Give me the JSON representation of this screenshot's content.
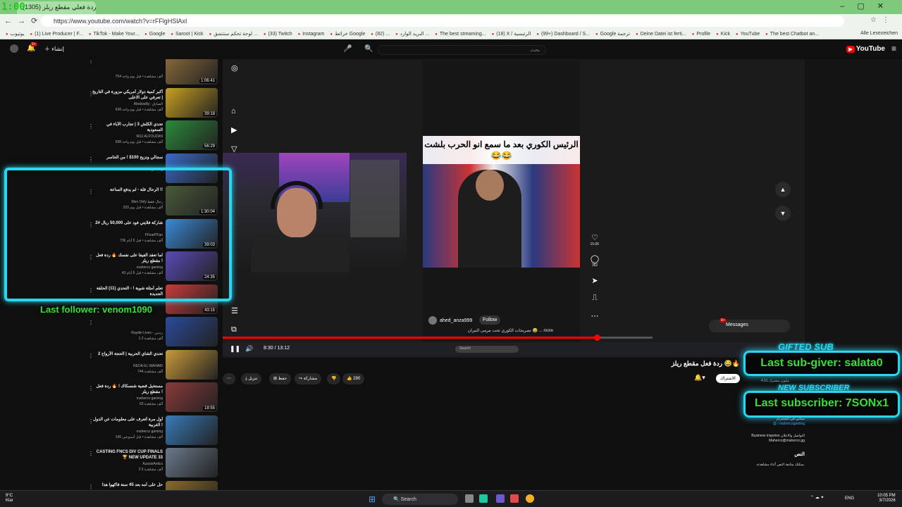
{
  "overlay": {
    "timer": "1:00",
    "last_follower": "Last follower: venom1090",
    "gifted_label": "GIFTED SUB",
    "last_sub_giver": "Last sub-giver: salata0",
    "new_sub_label": "NEW SUBSCRIBER",
    "last_subscriber": "Last subscriber: 7SONx1",
    "box_color": "#2ad6ef",
    "text_color": "#36e036"
  },
  "browser": {
    "tab_title": "(1305) ردة فعلي مقطع ريلز",
    "url": "https://www.youtube.com/watch?v=rFFlgHSlAxI",
    "bookmarks": [
      "يوتيوب",
      "(1) Live Producer | F...",
      "TikTok - Make Your...",
      "Google",
      "Saroot | Kick",
      "لوحة تحكم ستتشق ...",
      "(33) Twitch",
      "Instagram",
      "خرائط Google",
      "(82) ...",
      "البريد الوارد ...",
      "The best streaming...",
      "(18) X / الرئيسية",
      "(99+) Dashboard / S...",
      "Google ترجمة",
      "Deine Datei ist ferti...",
      "Profile",
      "Kick",
      "YouTube",
      "The best Chatbot an..."
    ],
    "all_bookmarks": "Alle Lesezeichen"
  },
  "youtube": {
    "logo": "YouTube",
    "search_placeholder": "بحث",
    "create_label": "إنشاء",
    "notif_count": "9+"
  },
  "sidebar": {
    "items": [
      {
        "title": "",
        "channel": "",
        "meta": "754 ألف مشاهدة • قبل يوم واحد",
        "duration": "1:06:41",
        "color": "#8a6a3a"
      },
      {
        "title": "أكبر كمية دولار أمريكي مزورة في التاريخ | تعرفي على الاعلى",
        "channel": "Abalsadiq - الصادق",
        "meta": "638 ألف مشاهدة • قبل يوم واحد",
        "duration": "39:18",
        "color": "#c8a020"
      },
      {
        "title": "تحدي الكلش 3 | تجارب الأباء في السعودية",
        "channel": "M12 ALFOUZAN",
        "meta": "598 ألف مشاهدة • قبل يوم واحد",
        "duration": "56:29",
        "color": "#2a8a3a"
      },
      {
        "title": "سجالي ونزيح 100$ ! من الخاسر",
        "channel": "maherco gaming",
        "meta": "",
        "duration": "",
        "color": "#3a6ac8"
      },
      {
        "title": "الرحال فلة - لم يدفع الساعة !!",
        "channel": "Men Only رجال فقط",
        "meta": "333 ألف مشاهدة • قبل يوم",
        "duration": "1:30:04",
        "color": "#4a5a3a"
      },
      {
        "title": "شاركة فلايتي فود على 50,000 ريال #2",
        "channel": "FFearPFan",
        "meta": "736 ألف مشاهدة • قبل 6 أيام",
        "duration": "39:03",
        "color": "#3a8ad8"
      },
      {
        "title": "لما تعقد الفيفا على نفسك 🔥 ردة فعل مقطع ريلز !",
        "channel": "maherco gaming",
        "meta": "43 ألف مشاهدة • قبل 6 أيام",
        "duration": "24:35",
        "color": "#5a4ab8"
      },
      {
        "title": "تعلم أمثلة شوية ! - التحدي (11) الحلقة الجديدة",
        "channel": "AZAD",
        "meta": "",
        "duration": "43:15",
        "color": "#c83a3a"
      },
      {
        "title": "",
        "channel": "Raydin Lives - ريدين",
        "meta": "1.2 ألف مشاهدة",
        "duration": "",
        "color": "#2a4a9a"
      },
      {
        "title": "تحدي الشاي الحربية | الحجة الأرواح 2",
        "channel": "REDA EL WAHABI",
        "meta": "744 ألف مشاهدة",
        "duration": "",
        "color": "#c89a3a"
      },
      {
        "title": "مستخيل قضية شنسكاك ! 🔥 ردة فعل مقطع ريلز !",
        "channel": "maherco gaming",
        "meta": "63 ألف مشاهدة",
        "duration": "18:55",
        "color": "#8a3a3a"
      },
      {
        "title": "أول مرة أتعرف على معلومات عن الدول الغربية !",
        "channel": "maherco gaming",
        "meta": "106 ألف مشاهدة • قبل أسبوعين",
        "duration": "",
        "color": "#3a7ab8"
      },
      {
        "title": "CASTING FNCS DIV CUP FINALS 🏆 NEW UPDATE 33",
        "channel": "AussieAntics",
        "meta": "2.5 ألف مشاهدة",
        "duration": "",
        "color": "#6a7a8a"
      },
      {
        "title": "حل على أمه بعد 45 سنة فاكهوا هذا",
        "channel": "maherco gaming",
        "meta": "",
        "duration": "",
        "color": "#8a6a2a"
      }
    ]
  },
  "player": {
    "short_caption": "الرئيس الكوري بعد ما سمع انو الحرب بلشت 😂😂",
    "likes": "15.6K",
    "comments": "382",
    "author": "ahed_anza999",
    "follow": "Follow",
    "short_desc": "تصريحات الكوري تحت مرمى النيران 😂 ... more",
    "time": "8:30 / 13:12",
    "progress": 0.87,
    "messages": "Messages",
    "messages_badge": "9+",
    "taskbar_search": "Search"
  },
  "video": {
    "title": "ردة فعل مقطع ريلز 😂🔥",
    "subscribe": "الاشتراك",
    "subs": "4.51 مليون مشترك",
    "likes": "290",
    "share": "مشاركة",
    "save": "حفظ",
    "download": "تنزيل",
    "description": [
      "ستاني في الشجرام",
      "@ / mahercogaming",
      "",
      "Business inquiries التواصل والاعلان",
      "Maherco@maherco.gg"
    ],
    "transcript_heading": "النص",
    "transcript_note": "يمكنك متابعة النص أثناء مشاهدته."
  },
  "taskbar": {
    "weather_temp": "9°C",
    "weather_text": "Klar",
    "search": "Search",
    "lang": "ENG",
    "time": "10:05 PM",
    "date": "3/7/2026"
  }
}
